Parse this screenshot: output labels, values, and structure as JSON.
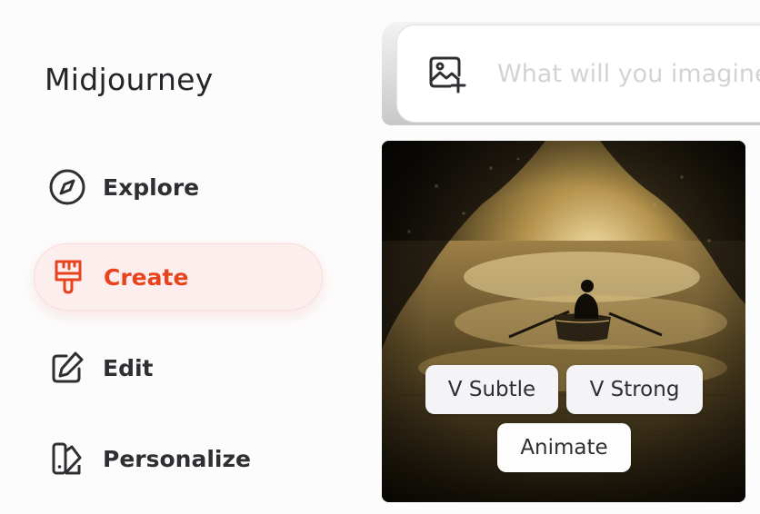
{
  "brand": {
    "name": "Midjourney"
  },
  "nav": {
    "items": [
      {
        "label": "Explore",
        "icon": "compass-icon",
        "active": false
      },
      {
        "label": "Create",
        "icon": "paintbrush-icon",
        "active": true
      },
      {
        "label": "Edit",
        "icon": "pencil-square-icon",
        "active": false
      },
      {
        "label": "Personalize",
        "icon": "palette-swatch-icon",
        "active": false
      }
    ]
  },
  "prompt": {
    "placeholder": "What will you imagine?",
    "add_image_icon": "image-plus-icon"
  },
  "result": {
    "image_description_icon": "generated-image",
    "actions": {
      "vary_subtle": "V Subtle",
      "vary_strong": "V Strong",
      "animate": "Animate"
    }
  },
  "colors": {
    "accent": "#e8431f",
    "active_bg": "#fdeeee",
    "text": "#2f2f33",
    "placeholder": "#d3d3d6"
  }
}
